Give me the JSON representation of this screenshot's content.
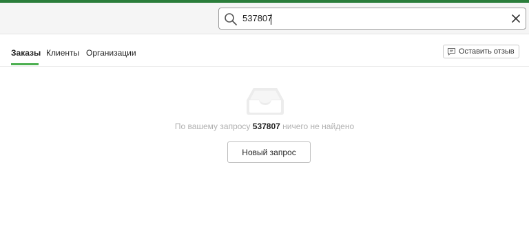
{
  "search": {
    "value": "537807"
  },
  "tabs": [
    {
      "label": "Заказы",
      "active": true
    },
    {
      "label": "Клиенты",
      "active": false
    },
    {
      "label": "Организации",
      "active": false
    }
  ],
  "feedback_button": {
    "label": "Оставить отзыв"
  },
  "empty_state": {
    "prefix": "По вашему запросу",
    "query": "537807",
    "suffix": "ничего не найдено",
    "button_label": "Новый запрос"
  },
  "colors": {
    "accent": "#2a7d3a",
    "tab_indicator": "#4caf50"
  },
  "icons": {
    "search": "search-icon",
    "clear": "close-icon",
    "feedback": "chat-bubble-icon",
    "empty": "empty-inbox-icon"
  }
}
